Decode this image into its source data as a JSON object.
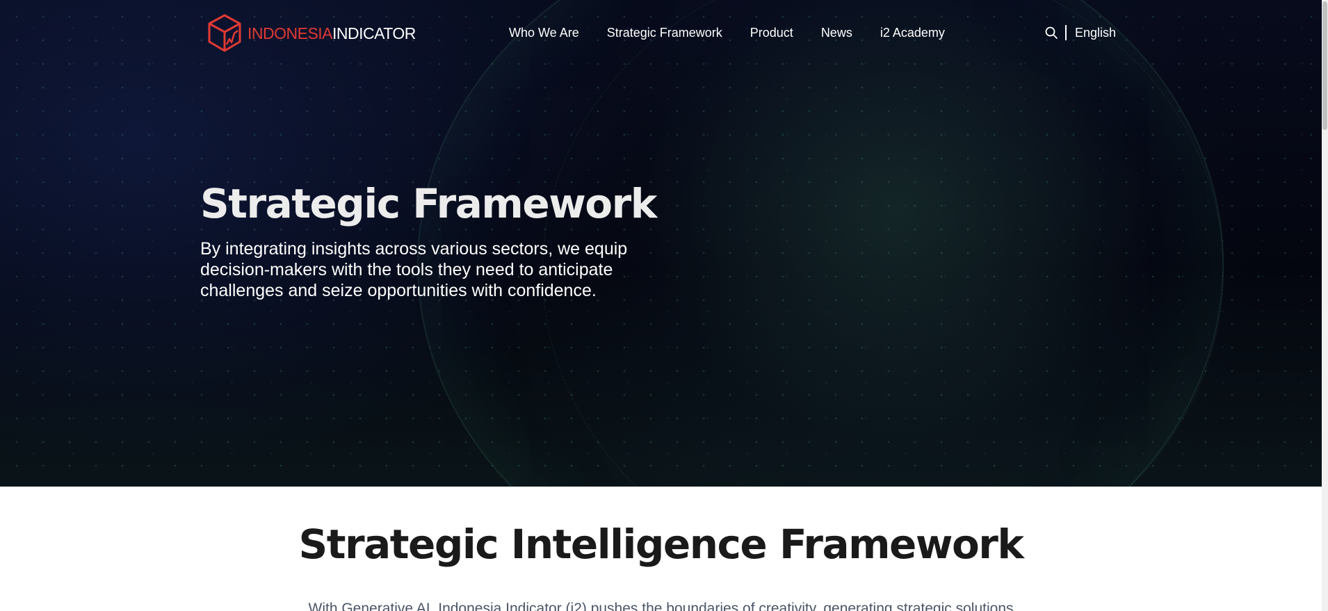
{
  "header": {
    "logo_text_red": "INDONESIA",
    "logo_text_white": "INDICATOR",
    "nav": [
      {
        "label": "Who We Are"
      },
      {
        "label": "Strategic Framework"
      },
      {
        "label": "Product"
      },
      {
        "label": "News"
      },
      {
        "label": "i2 Academy"
      }
    ],
    "language": "English"
  },
  "hero": {
    "title": "Strategic Framework",
    "subtitle": "By integrating insights across various sectors, we equip decision-makers with the tools they need to anticipate challenges and seize opportunities with confidence."
  },
  "section": {
    "title": "Strategic Intelligence Framework",
    "text": "With Generative AI, Indonesia Indicator (i2) pushes the boundaries of creativity, generating strategic solutions"
  },
  "colors": {
    "brand_red": "#e33a34",
    "hero_bg": "#05070f",
    "heading_dark": "#1a1a1a"
  },
  "icons": {
    "logo": "cube-chart-logo-icon",
    "search": "search-icon"
  }
}
